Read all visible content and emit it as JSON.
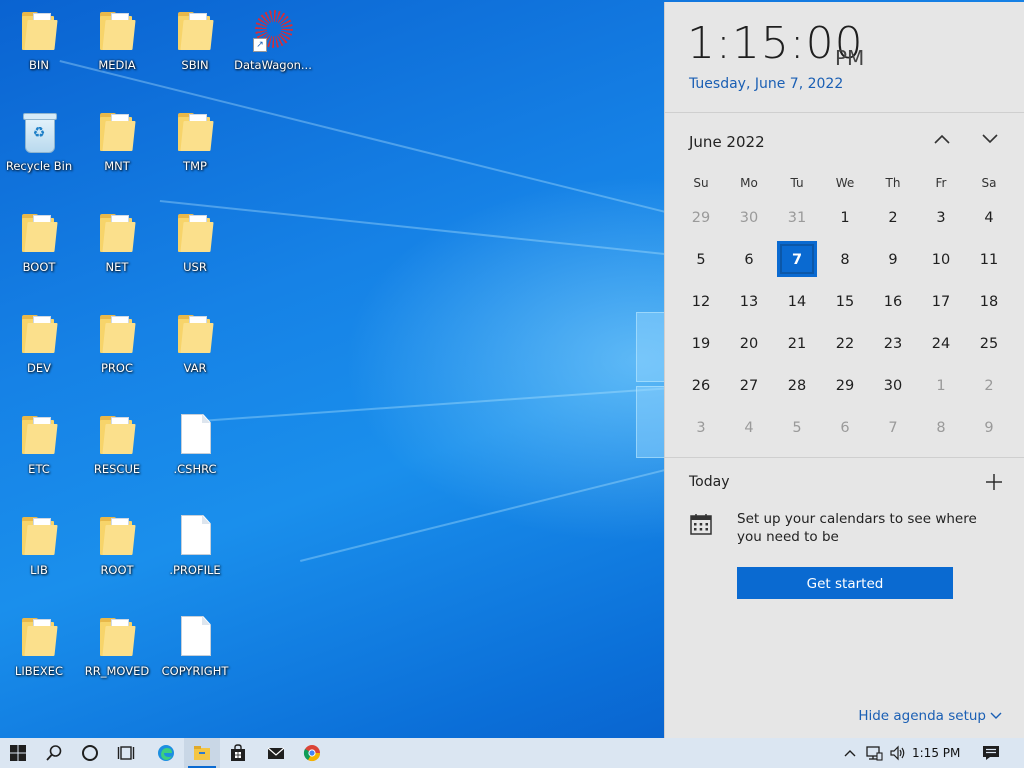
{
  "desktop": {
    "icons": [
      {
        "label": "BIN",
        "type": "folder"
      },
      {
        "label": "MEDIA",
        "type": "folder"
      },
      {
        "label": "SBIN",
        "type": "folder"
      },
      {
        "label": "DataWagon...",
        "type": "app"
      },
      {
        "label": "Recycle Bin",
        "type": "bin"
      },
      {
        "label": "MNT",
        "type": "folder"
      },
      {
        "label": "TMP",
        "type": "folder"
      },
      {
        "label": "BOOT",
        "type": "folder"
      },
      {
        "label": "NET",
        "type": "folder"
      },
      {
        "label": "USR",
        "type": "folder"
      },
      {
        "label": "DEV",
        "type": "folder"
      },
      {
        "label": "PROC",
        "type": "folder"
      },
      {
        "label": "VAR",
        "type": "folder"
      },
      {
        "label": "ETC",
        "type": "folder"
      },
      {
        "label": "RESCUE",
        "type": "folder"
      },
      {
        "label": ".CSHRC",
        "type": "file"
      },
      {
        "label": "LIB",
        "type": "folder"
      },
      {
        "label": "ROOT",
        "type": "folder"
      },
      {
        "label": ".PROFILE",
        "type": "file"
      },
      {
        "label": "LIBEXEC",
        "type": "folder"
      },
      {
        "label": "RR_MOVED",
        "type": "folder"
      },
      {
        "label": "COPYRIGHT",
        "type": "file"
      }
    ]
  },
  "flyout": {
    "time": "1:15:00",
    "ampm": "PM",
    "date": "Tuesday, June 7, 2022",
    "calendar": {
      "month_label": "June 2022",
      "weekdays": [
        "Su",
        "Mo",
        "Tu",
        "We",
        "Th",
        "Fr",
        "Sa"
      ],
      "weeks": [
        [
          {
            "d": "29",
            "dim": true
          },
          {
            "d": "30",
            "dim": true
          },
          {
            "d": "31",
            "dim": true
          },
          {
            "d": "1"
          },
          {
            "d": "2"
          },
          {
            "d": "3"
          },
          {
            "d": "4"
          }
        ],
        [
          {
            "d": "5"
          },
          {
            "d": "6"
          },
          {
            "d": "7",
            "today": true
          },
          {
            "d": "8"
          },
          {
            "d": "9"
          },
          {
            "d": "10"
          },
          {
            "d": "11"
          }
        ],
        [
          {
            "d": "12"
          },
          {
            "d": "13"
          },
          {
            "d": "14"
          },
          {
            "d": "15"
          },
          {
            "d": "16"
          },
          {
            "d": "17"
          },
          {
            "d": "18"
          }
        ],
        [
          {
            "d": "19"
          },
          {
            "d": "20"
          },
          {
            "d": "21"
          },
          {
            "d": "22"
          },
          {
            "d": "23"
          },
          {
            "d": "24"
          },
          {
            "d": "25"
          }
        ],
        [
          {
            "d": "26"
          },
          {
            "d": "27"
          },
          {
            "d": "28"
          },
          {
            "d": "29"
          },
          {
            "d": "30"
          },
          {
            "d": "1",
            "dim": true
          },
          {
            "d": "2",
            "dim": true
          }
        ],
        [
          {
            "d": "3",
            "dim": true
          },
          {
            "d": "4",
            "dim": true
          },
          {
            "d": "5",
            "dim": true
          },
          {
            "d": "6",
            "dim": true
          },
          {
            "d": "7",
            "dim": true
          },
          {
            "d": "8",
            "dim": true
          },
          {
            "d": "9",
            "dim": true
          }
        ]
      ]
    },
    "agenda": {
      "title": "Today",
      "message": "Set up your calendars to see where you need to be",
      "button": "Get started",
      "hide_link": "Hide agenda setup"
    }
  },
  "taskbar": {
    "items": [
      "start-icon",
      "search-icon",
      "cortana-icon",
      "task-view-icon",
      "edge-icon",
      "file-explorer-icon",
      "store-icon",
      "mail-icon",
      "chrome-icon"
    ],
    "tray": [
      "show-hidden-icons-chevron",
      "network-icon",
      "volume-icon"
    ],
    "time": "1:15 PM",
    "notifications_icon": "action-center-icon"
  },
  "colors": {
    "accent": "#0a6ad1",
    "link": "#1a5fb4",
    "flyout_bg": "#e6e6e6",
    "taskbar_bg": "#dbe6f2"
  }
}
